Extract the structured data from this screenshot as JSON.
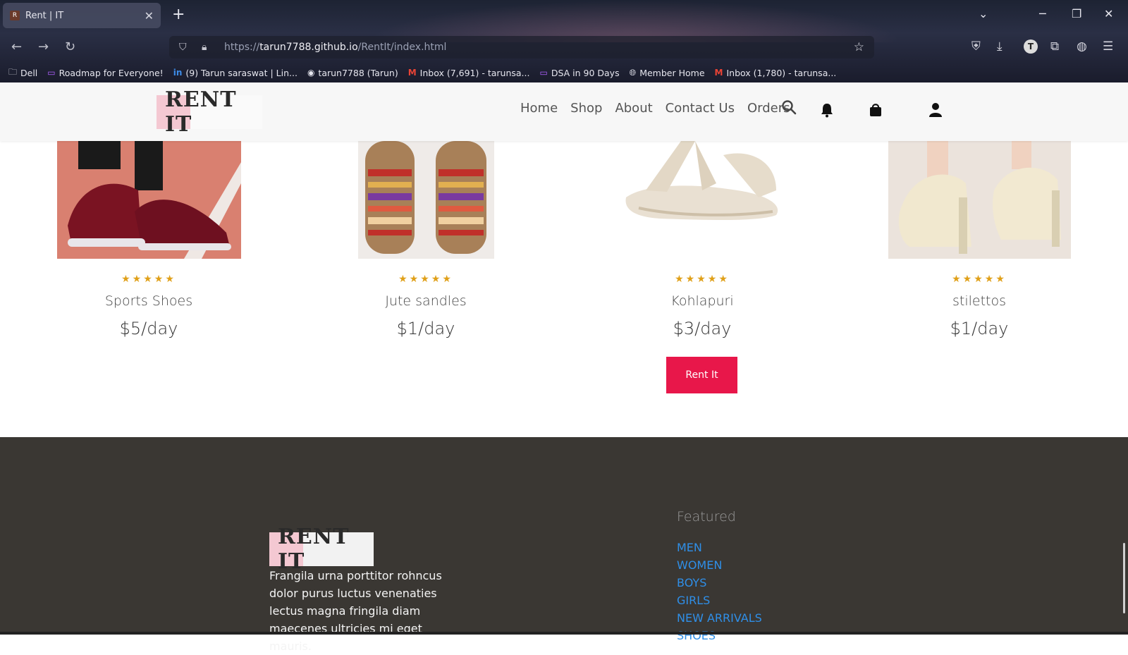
{
  "browser": {
    "tab_title": "Rent | IT",
    "tab_favicon": "R",
    "url_prefix": "https://",
    "url_host": "tarun7788.github.io",
    "url_path": "/RentIt/index.html",
    "profile_initial": "T",
    "bookmarks": [
      {
        "icon": "folder-icon",
        "label": "Dell"
      },
      {
        "icon": "roadmap-icon",
        "label": "Roadmap for Everyone!"
      },
      {
        "icon": "linkedin-icon",
        "label": "(9) Tarun saraswat | Lin..."
      },
      {
        "icon": "github-icon",
        "label": "tarun7788 (Tarun)"
      },
      {
        "icon": "gmail-icon",
        "label": "Inbox (7,691) - tarunsa..."
      },
      {
        "icon": "dsa-icon",
        "label": "DSA in 90 Days"
      },
      {
        "icon": "globe-icon",
        "label": "Member Home"
      },
      {
        "icon": "gmail-icon",
        "label": "Inbox (1,780) - tarunsa..."
      }
    ]
  },
  "header": {
    "logo": "RENT IT",
    "nav": [
      "Home",
      "Shop",
      "About",
      "Contact Us",
      "Orders"
    ]
  },
  "products": [
    {
      "name": "Sports Shoes",
      "price": "$5/day",
      "stars": "★★★★★"
    },
    {
      "name": "Jute sandles",
      "price": "$1/day",
      "stars": "★★★★★"
    },
    {
      "name": "Kohlapuri",
      "price": "$3/day",
      "stars": "★★★★★"
    },
    {
      "name": "stilettos",
      "price": "$1/day",
      "stars": "★★★★★"
    }
  ],
  "rent_button": "Rent It",
  "footer": {
    "logo": "RENT IT",
    "text": "Frangila urna porttitor rohncus dolor purus luctus venenaties lectus magna fringila diam maecenes ultricies mi eget mauris.",
    "featured_title": "Featured",
    "featured_links": [
      "MEN",
      "WOMEN",
      "BOYS",
      "GIRLS",
      "NEW ARRIVALS",
      "SHOES"
    ]
  },
  "colors": {
    "accent": "#e8174a",
    "link": "#2f8fe8",
    "footer_bg": "#3a3733",
    "star": "#e0a019",
    "logo_pink": "#f4c8d2"
  }
}
